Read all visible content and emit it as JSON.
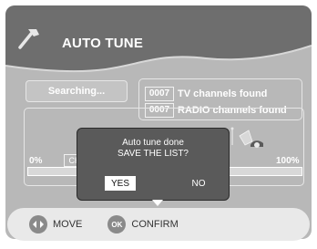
{
  "header": {
    "title": "AUTO TUNE",
    "icon": "wrench-icon"
  },
  "status": {
    "label": "Searching..."
  },
  "results": {
    "tv_count": "0007",
    "tv_label": "TV channels found",
    "radio_count": "0007",
    "radio_label": "RADIO channels found"
  },
  "progress": {
    "min_label": "0%",
    "max_label": "100%",
    "channel_label": "CH",
    "value_percent": 100,
    "icon": "satellite-dish-icon"
  },
  "dialog": {
    "line1": "Auto tune done",
    "line2": "SAVE THE LIST?",
    "yes_label": "YES",
    "no_label": "NO"
  },
  "footer": {
    "move_label": "MOVE",
    "move_icon": "left-right-arrows-icon",
    "confirm_icon_label": "OK",
    "confirm_label": "CONFIRM"
  },
  "colors": {
    "panel": "#b8b8b8",
    "header": "#6e6e6e",
    "dialog": "#5a5a5a",
    "footer": "#e9e9e9"
  }
}
